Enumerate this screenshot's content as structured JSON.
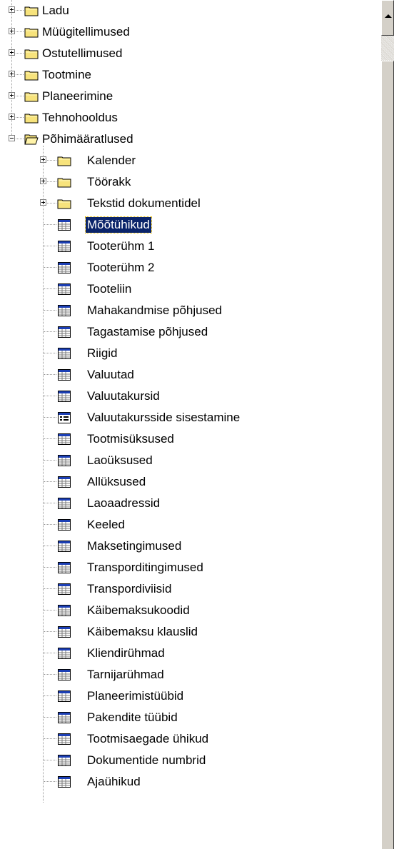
{
  "tree": {
    "top_items": [
      {
        "label": "Ladu",
        "expanded": false
      },
      {
        "label": "Müügitellimused",
        "expanded": false
      },
      {
        "label": "Ostutellimused",
        "expanded": false
      },
      {
        "label": "Tootmine",
        "expanded": false
      },
      {
        "label": "Planeerimine",
        "expanded": false
      },
      {
        "label": "Tehnohooldus",
        "expanded": false
      },
      {
        "label": "Põhimääratlused",
        "expanded": true
      }
    ],
    "child_items": [
      {
        "label": "Kalender",
        "type": "folder"
      },
      {
        "label": "Töörakk",
        "type": "folder"
      },
      {
        "label": "Tekstid dokumentidel",
        "type": "folder"
      },
      {
        "label": "Mõõtühikud",
        "type": "table",
        "selected": true
      },
      {
        "label": "Tooterühm 1",
        "type": "table"
      },
      {
        "label": "Tooterühm 2",
        "type": "table"
      },
      {
        "label": "Tooteliin",
        "type": "table"
      },
      {
        "label": "Mahakandmise põhjused",
        "type": "table"
      },
      {
        "label": "Tagastamise põhjused",
        "type": "table"
      },
      {
        "label": "Riigid",
        "type": "table"
      },
      {
        "label": "Valuutad",
        "type": "table"
      },
      {
        "label": "Valuutakursid",
        "type": "table"
      },
      {
        "label": "Valuutakursside sisestamine",
        "type": "form"
      },
      {
        "label": "Tootmisüksused",
        "type": "table"
      },
      {
        "label": "Laoüksused",
        "type": "table"
      },
      {
        "label": "Allüksused",
        "type": "table"
      },
      {
        "label": "Laoaadressid",
        "type": "table"
      },
      {
        "label": "Keeled",
        "type": "table"
      },
      {
        "label": "Maksetingimused",
        "type": "table"
      },
      {
        "label": "Transporditingimused",
        "type": "table"
      },
      {
        "label": "Transpordiviisid",
        "type": "table"
      },
      {
        "label": "Käibemaksukoodid",
        "type": "table"
      },
      {
        "label": "Käibemaksu klauslid",
        "type": "table"
      },
      {
        "label": "Kliendirühmad",
        "type": "table"
      },
      {
        "label": "Tarnijarühmad",
        "type": "table"
      },
      {
        "label": "Planeerimistüübid",
        "type": "table"
      },
      {
        "label": "Pakendite tüübid",
        "type": "table"
      },
      {
        "label": "Tootmisaegade ühikud",
        "type": "table"
      },
      {
        "label": "Dokumentide numbrid",
        "type": "table"
      },
      {
        "label": "Ajaühikud",
        "type": "table"
      }
    ]
  },
  "colors": {
    "selection_bg": "#0a246a",
    "folder_fill": "#f7e37c",
    "table_header": "#1c3fb5"
  },
  "icons": {
    "folder": "folder-icon",
    "table": "table-icon",
    "form": "form-icon",
    "expander_plus": "plus-box-icon",
    "expander_minus": "minus-box-icon",
    "scroll_up": "arrow-up-icon"
  }
}
